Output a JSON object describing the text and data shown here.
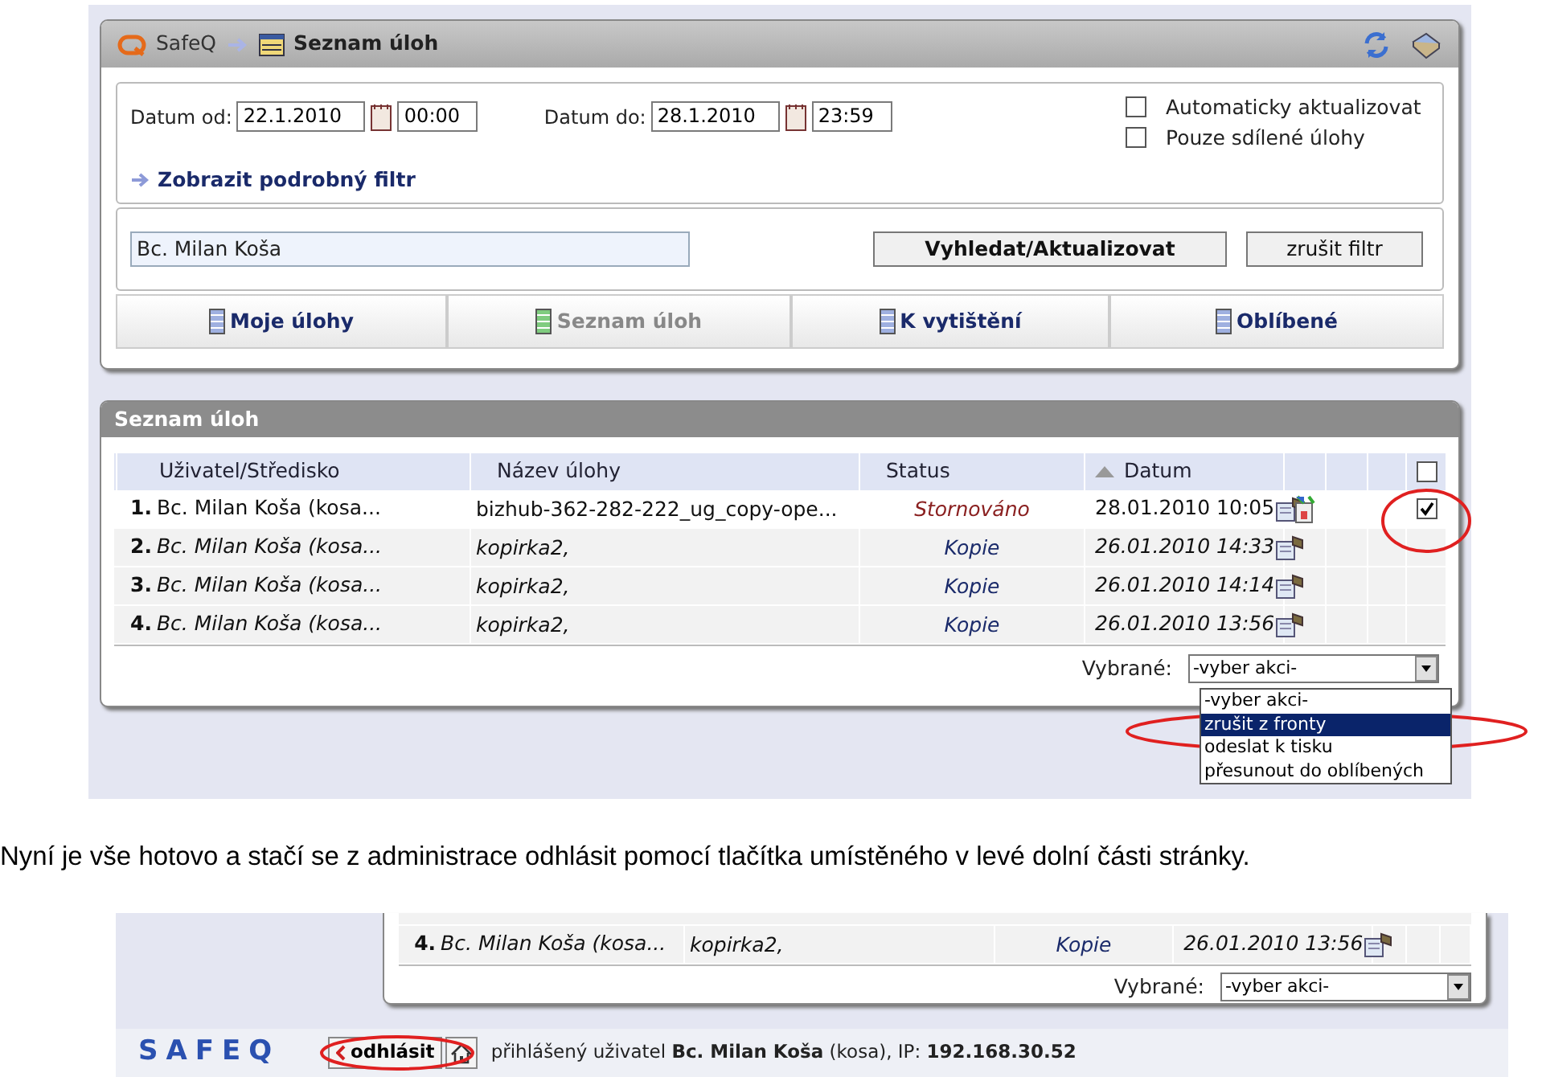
{
  "top_screenshot": {
    "breadcrumb": {
      "app": "SafeQ",
      "page": "Seznam úloh"
    },
    "filter": {
      "date_from_label": "Datum od:",
      "date_from": "22.1.2010",
      "time_from": "00:00",
      "date_to_label": "Datum do:",
      "date_to": "28.1.2010",
      "time_to": "23:59",
      "options": [
        {
          "label": "Automaticky aktualizovat",
          "checked": false
        },
        {
          "label": "Pouze sdílené úlohy",
          "checked": false
        }
      ],
      "detail_link": "Zobrazit podrobný filtr"
    },
    "search": {
      "value": "Bc. Milan Koša",
      "buttons": [
        "Vyhledat/Aktualizovat",
        "zrušit filtr"
      ]
    },
    "tabs": [
      {
        "label": "Moje úlohy",
        "selected": false
      },
      {
        "label": "Seznam úloh",
        "selected": true
      },
      {
        "label": "K vytištění",
        "selected": false
      },
      {
        "label": "Oblíbené",
        "selected": false
      }
    ],
    "task_list": {
      "title": "Seznam úloh",
      "columns": [
        "Uživatel/Středisko",
        "Název úlohy",
        "Status",
        "Datum"
      ],
      "select_all_checked": false,
      "rows": [
        {
          "index": "1.",
          "user": "Bc. Milan Koša (kosa...",
          "name": "bizhub-362-282-222_ug_copy-ope...",
          "status": "Stornováno",
          "date": "28.01.2010 10:05",
          "kind": "cancelled",
          "checked": true
        },
        {
          "index": "2.",
          "user": "Bc. Milan Koša (kosa...",
          "name": "kopirka2,",
          "status": "Kopie",
          "date": "26.01.2010 14:33",
          "kind": "copy"
        },
        {
          "index": "3.",
          "user": "Bc. Milan Koša (kosa...",
          "name": "kopirka2,",
          "status": "Kopie",
          "date": "26.01.2010 14:14",
          "kind": "copy"
        },
        {
          "index": "4.",
          "user": "Bc. Milan Koša (kosa...",
          "name": "kopirka2,",
          "status": "Kopie",
          "date": "26.01.2010 13:56",
          "kind": "copy"
        }
      ],
      "selected_label": "Vybrané:",
      "action_select": "-vyber akci-",
      "action_menu": [
        {
          "label": "-vyber akci-",
          "selected": false
        },
        {
          "label": "zrušit z fronty",
          "selected": true
        },
        {
          "label": "odeslat k tisku",
          "selected": false
        },
        {
          "label": "přesunout do oblíbených",
          "selected": false
        }
      ]
    }
  },
  "caption": "Nyní je vše hotovo a stačí se z administrace odhlásit pomocí tlačítka umístěného v levé dolní části stránky.",
  "bottom_screenshot": {
    "rows": [
      {
        "index": "4.",
        "user": "Bc. Milan Koša (kosa...",
        "name": "kopirka2,",
        "status": "Kopie",
        "date": "26.01.2010 13:56",
        "kind": "copy"
      }
    ],
    "selected_label": "Vybrané:",
    "action_select": "-vyber akci-",
    "footer": {
      "logo": "SAFEQ",
      "logout": "odhlásit",
      "user_info": "přihlášený uživatel **Bc. Milan Koša** (kosa), IP: **192.168.30.52**"
    }
  }
}
